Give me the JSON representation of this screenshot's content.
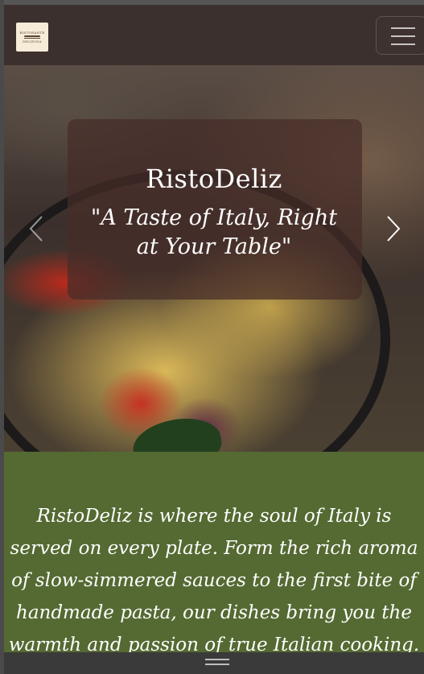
{
  "brand": {
    "logo_line1": "RISTORANTE",
    "logo_line2": "DELIZIOSA",
    "accent": "#546a32",
    "navbar_bg": "#3b302d"
  },
  "navbar": {
    "toggler_icon": "hamburger-menu-icon"
  },
  "hero": {
    "title": "RistoDeliz",
    "tagline": "\"A Taste of Italy, Right at Your Table\"",
    "prev_icon": "chevron-left-icon",
    "next_icon": "chevron-right-icon"
  },
  "about": {
    "text": "RistoDeliz is where the soul of Italy is served on every plate. Form the rich aroma of slow-simmered sauces to the first bite of handmade pasta, our dishes bring you the warmth and passion of true Italian cooking."
  },
  "bottom": {
    "handle_icon": "drag-handle-icon"
  }
}
